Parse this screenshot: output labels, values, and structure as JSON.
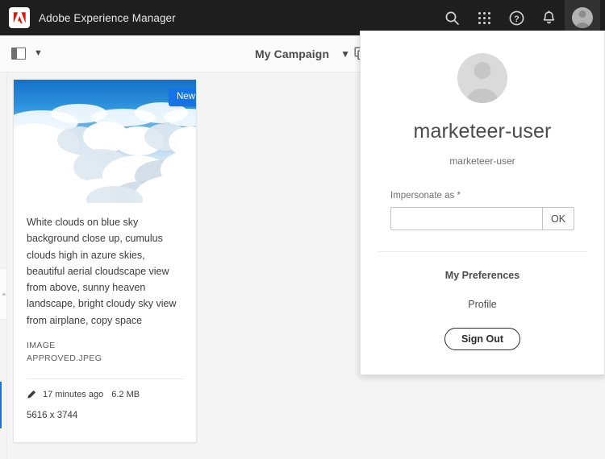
{
  "header": {
    "brand_title": "Adobe Experience Manager",
    "logo_icon": "adobe-logo-icon",
    "actions": [
      {
        "name": "search-icon",
        "label": "Search"
      },
      {
        "name": "app-grid-icon",
        "label": "Solutions"
      },
      {
        "name": "help-icon",
        "label": "Help"
      },
      {
        "name": "bell-icon",
        "label": "Notifications"
      }
    ],
    "avatar_icon": "user-avatar-icon"
  },
  "toolbar": {
    "rail_toggle_icon": "rail-panel-icon",
    "rail_chevron_icon": "chevron-down-icon",
    "campaign_label": "My Campaign",
    "campaign_chevron_icon": "chevron-down-icon",
    "view_icon": "copy-card-view-icon"
  },
  "card": {
    "badge": "New",
    "description": "White clouds on blue sky background close up, cumulus clouds high in azure skies, beautiful aerial cloudscape view from above, sunny heaven landscape, bright cloudy sky view from airplane, copy space",
    "type_line": "IMAGE",
    "file_name": "APPROVED.JPEG",
    "edit_icon": "pencil-icon",
    "modified": "17 minutes ago",
    "size": "6.2 MB",
    "dimensions": "5616 x 3744",
    "thumbnail_alt": "clouds-thumbnail"
  },
  "user_panel": {
    "avatar_icon": "user-avatar-large-icon",
    "display_name": "marketeer-user",
    "user_id": "marketeer-user",
    "impersonate_label": "Impersonate as *",
    "impersonate_value": "",
    "impersonate_placeholder": "",
    "ok_label": "OK",
    "my_preferences_label": "My Preferences",
    "profile_label": "Profile",
    "sign_out_label": "Sign Out"
  },
  "colors": {
    "header_bg": "#1f1f1f",
    "accent_blue": "#1473e6",
    "page_bg": "#f4f4f4",
    "card_bg": "#ffffff"
  }
}
